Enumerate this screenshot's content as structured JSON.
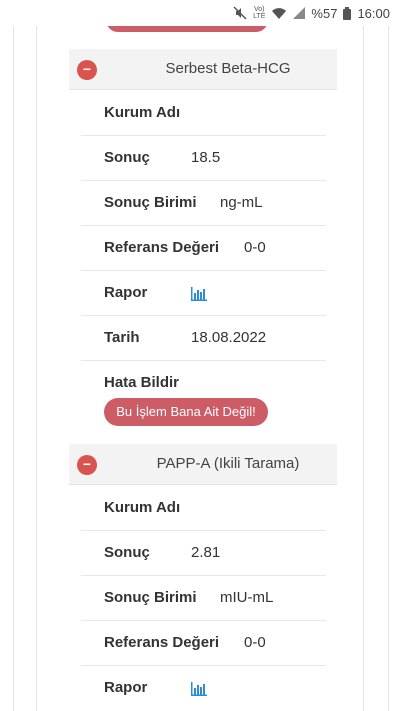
{
  "status_bar": {
    "network": "LTE",
    "battery": "%57",
    "time": "16:00"
  },
  "cards": [
    {
      "title": "Serbest Beta-HCG",
      "rows": {
        "institution_label": "Kurum Adı",
        "institution_value": "",
        "result_label": "Sonuç",
        "result_value": "18.5",
        "unit_label": "Sonuç Birimi",
        "unit_value": "ng-mL",
        "reference_label": "Referans Değeri",
        "reference_value": "0-0",
        "report_label": "Rapor",
        "date_label": "Tarih",
        "date_value": "18.08.2022",
        "error_label": "Hata Bildir",
        "error_button": "Bu İşlem Bana Ait Değil!"
      }
    },
    {
      "title": "PAPP-A (Ikili Tarama)",
      "rows": {
        "institution_label": "Kurum Adı",
        "institution_value": "",
        "result_label": "Sonuç",
        "result_value": "2.81",
        "unit_label": "Sonuç Birimi",
        "unit_value": "mIU-mL",
        "reference_label": "Referans Değeri",
        "reference_value": "0-0",
        "report_label": "Rapor"
      }
    }
  ],
  "colors": {
    "accent_red": "#cc5c65",
    "minus_red": "#d9534f",
    "chart_blue": "#2e8bd6"
  },
  "icons": {
    "collapse": "minus-circle-icon",
    "report": "bar-chart-icon"
  }
}
